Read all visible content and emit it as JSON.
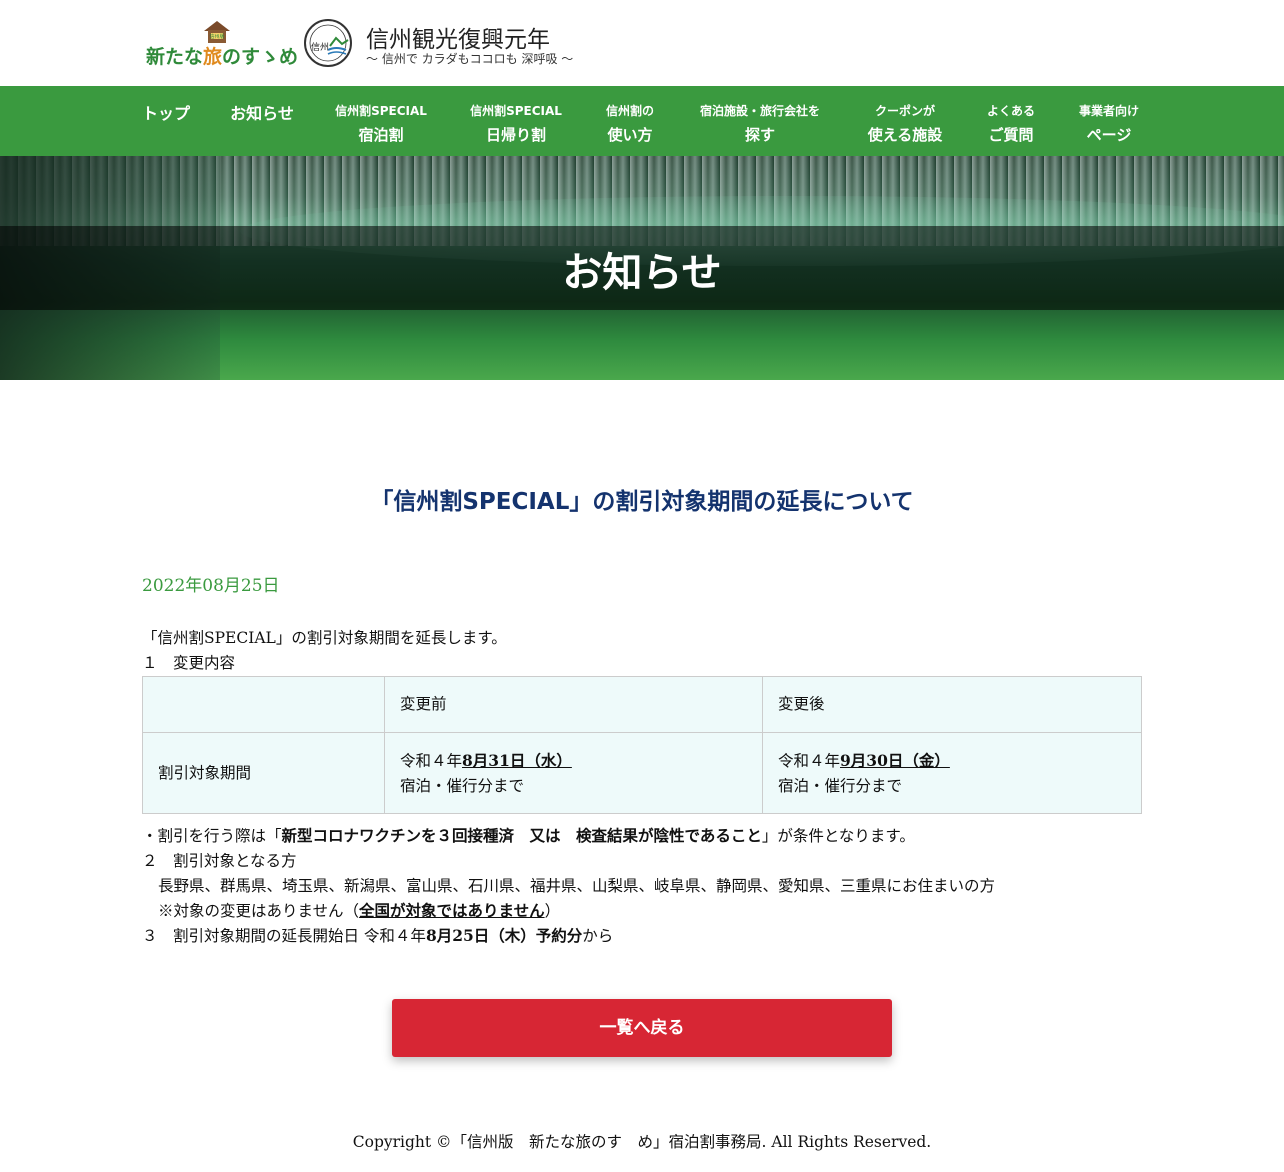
{
  "header": {
    "logo1_text_a": "新たな",
    "logo1_text_b": "旅",
    "logo1_text_c": "のすゝめ",
    "logo1_badge": "信州版",
    "logo2_title": "信州観光復興元年",
    "logo2_sub": "〜 信州で カラダもココロも 深呼吸 〜",
    "logo2_seal_text": "信州"
  },
  "nav": {
    "items": [
      {
        "single": "トップ"
      },
      {
        "single": "お知らせ"
      },
      {
        "small": "信州割SPECIAL",
        "big": "宿泊割"
      },
      {
        "small": "信州割SPECIAL",
        "big": "日帰り割"
      },
      {
        "small": "信州割の",
        "big": "使い方"
      },
      {
        "small": "宿泊施設・旅行会社を",
        "big": "探す"
      },
      {
        "small": "クーポンが",
        "big": "使える施設"
      },
      {
        "small": "よくある",
        "big": "ご質問"
      },
      {
        "small": "事業者向け",
        "big": "ページ"
      }
    ]
  },
  "hero": {
    "title": "お知らせ"
  },
  "article": {
    "title": "「信州割SPECIAL」の割引対象期間の延長について",
    "date": "2022年08月25日",
    "intro": "「信州割SPECIAL」の割引対象期間を延長します。",
    "section1": "１　変更内容",
    "table": {
      "header": [
        "",
        "変更前",
        "変更後"
      ],
      "row_label": "割引対象期間",
      "before_prefix": "令和４年",
      "before_date": "8月31日（水）",
      "before_suffix": "宿泊・催行分まで",
      "after_prefix": "令和４年",
      "after_date": "9月30日（金）",
      "after_suffix": "宿泊・催行分まで"
    },
    "note_prefix": "・割引を行う際は「",
    "note_bold": "新型コロナワクチンを３回接種済　又は　検査結果が陰性であること",
    "note_suffix": "」が条件となります。",
    "section2": "２　割引対象となる方",
    "prefectures": "長野県、群馬県、埼玉県、新潟県、富山県、石川県、福井県、山梨県、岐阜県、静岡県、愛知県、三重県にお住まいの方",
    "change_note_prefix": "※対象の変更はありません（",
    "change_note_bold": "全国が対象ではありません",
    "change_note_suffix": "）",
    "section3_prefix": "３　割引対象期間の延長開始日 令和４年",
    "section3_bold": "8月25日（木）予約分",
    "section3_suffix": "から"
  },
  "back_button": "一覧へ戻る",
  "footer": "Copyright ©「信州版　新たな旅のす　め」宿泊割事務局. All Rights Reserved.",
  "colors": {
    "nav_green": "#3a9a3f",
    "title_navy": "#14336e",
    "date_green": "#3a9a3f",
    "button_red": "#d72634",
    "table_bg": "#eefafa"
  }
}
